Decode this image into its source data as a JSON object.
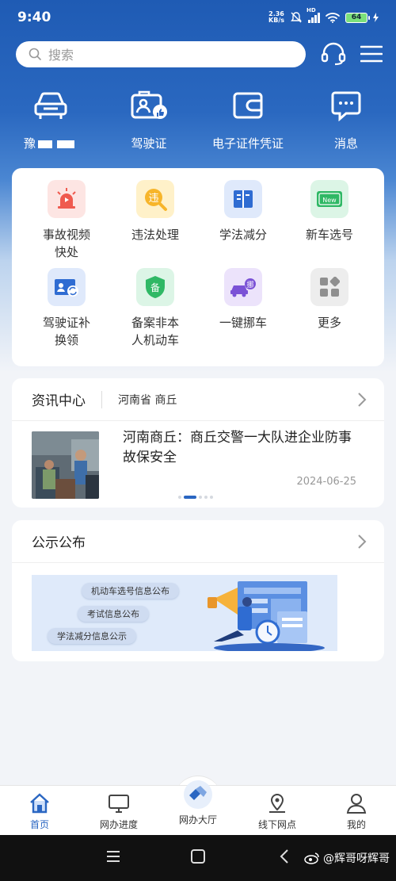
{
  "status": {
    "time": "9:40",
    "net_speed": "2.36",
    "net_unit": "KB/s",
    "hd": "HD",
    "battery": "64"
  },
  "search": {
    "placeholder": "搜索"
  },
  "quick": [
    {
      "label": "豫",
      "icon": "car-icon"
    },
    {
      "label": "驾驶证",
      "icon": "license-icon"
    },
    {
      "label": "电子证件凭证",
      "icon": "wallet-icon"
    },
    {
      "label": "消息",
      "icon": "message-icon"
    }
  ],
  "services": [
    {
      "label": "事故视频快处",
      "line1": "事故视频",
      "line2": "快处",
      "icon": "siren-icon",
      "bg": "#fde5e3"
    },
    {
      "label": "违法处理",
      "line1": "违法处理",
      "line2": "",
      "icon": "violation-icon",
      "bg": "#fff1c9"
    },
    {
      "label": "学法减分",
      "line1": "学法减分",
      "line2": "",
      "icon": "book-icon",
      "bg": "#dfe9fb"
    },
    {
      "label": "新车选号",
      "line1": "新车选号",
      "line2": "",
      "icon": "new-plate-icon",
      "bg": "#dcf5e6"
    },
    {
      "label": "驾驶证补换领",
      "line1": "驾驶证补",
      "line2": "换领",
      "icon": "license-renew-icon",
      "bg": "#dfe9fb"
    },
    {
      "label": "备案非本人机动车",
      "line1": "备案非本",
      "line2": "人机动车",
      "icon": "record-icon",
      "bg": "#dcf5e6",
      "badge": "备"
    },
    {
      "label": "一键挪车",
      "line1": "一键挪车",
      "line2": "",
      "icon": "move-car-icon",
      "bg": "#ece3fb",
      "badge": "挪"
    },
    {
      "label": "更多",
      "line1": "更多",
      "line2": "",
      "icon": "more-icon",
      "bg": "#ededed"
    }
  ],
  "badges": {
    "violation": "违",
    "new": "New"
  },
  "news": {
    "title": "资讯中心",
    "region": "河南省 商丘",
    "headline": "河南商丘：商丘交警一大队进企业防事故保安全",
    "date": "2024-06-25"
  },
  "publication": {
    "title": "公示公布",
    "pills": [
      "机动车选号信息公布",
      "考试信息公布",
      "学法减分信息公示"
    ]
  },
  "tabs": [
    {
      "label": "首页",
      "icon": "home-icon",
      "active": true
    },
    {
      "label": "网办进度",
      "icon": "monitor-icon",
      "active": false
    },
    {
      "label": "网办大厅",
      "icon": "hall-icon",
      "active": false
    },
    {
      "label": "线下网点",
      "icon": "location-icon",
      "active": false
    },
    {
      "label": "我的",
      "icon": "user-icon",
      "active": false
    }
  ],
  "watermark": "@辉哥呀辉哥",
  "colors": {
    "primary": "#2a66c2",
    "hero_top": "#1f5bb4",
    "background": "#f2f4f8"
  }
}
